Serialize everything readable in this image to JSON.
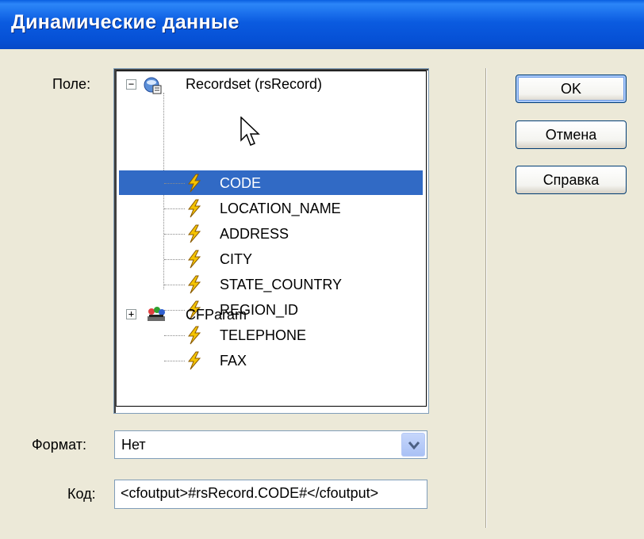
{
  "window": {
    "title": "Динамические данные"
  },
  "labels": {
    "field": "Поле:",
    "format": "Формат:",
    "code": "Код:"
  },
  "tree": {
    "recordset": {
      "label": "Recordset (rsRecord)",
      "expander": "−",
      "icon": "recordset-icon"
    },
    "fields": [
      {
        "label": "CODE",
        "selected": true
      },
      {
        "label": "LOCATION_NAME"
      },
      {
        "label": "ADDRESS"
      },
      {
        "label": "CITY"
      },
      {
        "label": "STATE_COUNTRY"
      },
      {
        "label": "REGION_ID"
      },
      {
        "label": "TELEPHONE"
      },
      {
        "label": "FAX"
      }
    ],
    "cfparam": {
      "label": "CFParam",
      "expander": "+",
      "icon": "cfparam-icon"
    }
  },
  "format": {
    "value": "Нет"
  },
  "code": {
    "value": "<cfoutput>#rsRecord.CODE#</cfoutput>"
  },
  "buttons": {
    "ok": "OK",
    "cancel": "Отмена",
    "help": "Справка"
  },
  "colors": {
    "titlebar": "#0651D6",
    "selection": "#316AC5",
    "face": "#ECE9D8"
  }
}
